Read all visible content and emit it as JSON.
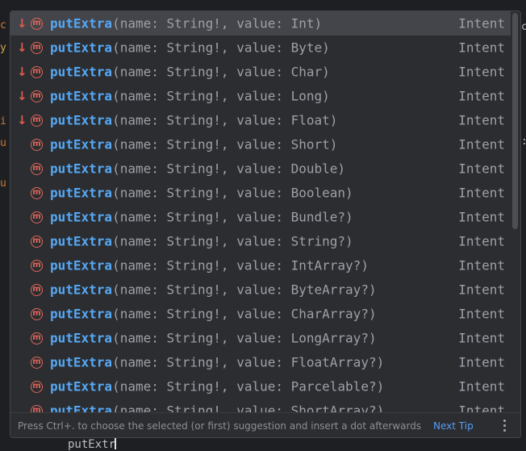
{
  "popup": {
    "items": [
      {
        "deprecated": true,
        "name": "putExtra",
        "sig": "(name: String!, value: Int)",
        "type": "Intent",
        "selected": true
      },
      {
        "deprecated": true,
        "name": "putExtra",
        "sig": "(name: String!, value: Byte)",
        "type": "Intent"
      },
      {
        "deprecated": true,
        "name": "putExtra",
        "sig": "(name: String!, value: Char)",
        "type": "Intent"
      },
      {
        "deprecated": true,
        "name": "putExtra",
        "sig": "(name: String!, value: Long)",
        "type": "Intent"
      },
      {
        "deprecated": true,
        "name": "putExtra",
        "sig": "(name: String!, value: Float)",
        "type": "Intent"
      },
      {
        "deprecated": false,
        "name": "putExtra",
        "sig": "(name: String!, value: Short)",
        "type": "Intent"
      },
      {
        "deprecated": false,
        "name": "putExtra",
        "sig": "(name: String!, value: Double)",
        "type": "Intent"
      },
      {
        "deprecated": false,
        "name": "putExtra",
        "sig": "(name: String!, value: Boolean)",
        "type": "Intent"
      },
      {
        "deprecated": false,
        "name": "putExtra",
        "sig": "(name: String!, value: Bundle?)",
        "type": "Intent"
      },
      {
        "deprecated": false,
        "name": "putExtra",
        "sig": "(name: String!, value: String?)",
        "type": "Intent"
      },
      {
        "deprecated": false,
        "name": "putExtra",
        "sig": "(name: String!, value: IntArray?)",
        "type": "Intent"
      },
      {
        "deprecated": false,
        "name": "putExtra",
        "sig": "(name: String!, value: ByteArray?)",
        "type": "Intent"
      },
      {
        "deprecated": false,
        "name": "putExtra",
        "sig": "(name: String!, value: CharArray?)",
        "type": "Intent"
      },
      {
        "deprecated": false,
        "name": "putExtra",
        "sig": "(name: String!, value: LongArray?)",
        "type": "Intent"
      },
      {
        "deprecated": false,
        "name": "putExtra",
        "sig": "(name: String!, value: FloatArray?)",
        "type": "Intent"
      },
      {
        "deprecated": false,
        "name": "putExtra",
        "sig": "(name: String!, value: Parcelable?)",
        "type": "Intent"
      },
      {
        "deprecated": false,
        "name": "putExtra",
        "sig": "(name: String!, value: ShortArray?)",
        "type": "Intent"
      }
    ],
    "footer": {
      "hint": "Press Ctrl+. to choose the selected (or first) suggestion and insert a dot afterwards",
      "next_tip": "Next Tip"
    }
  },
  "editor": {
    "typed_text": "putExtr"
  },
  "icons": {
    "deprecated": "down-arrow-icon",
    "method": "method-m-icon",
    "more": "more-vertical-icon"
  },
  "colors": {
    "background": "#1e1f22",
    "popup_bg": "#2b2d30",
    "selected_row": "#43454a",
    "method_name": "#56a8f5",
    "signature": "#9da0a8",
    "deprecated_arrow": "#e05a4f",
    "method_icon": "#e0675c",
    "link": "#589df6"
  }
}
